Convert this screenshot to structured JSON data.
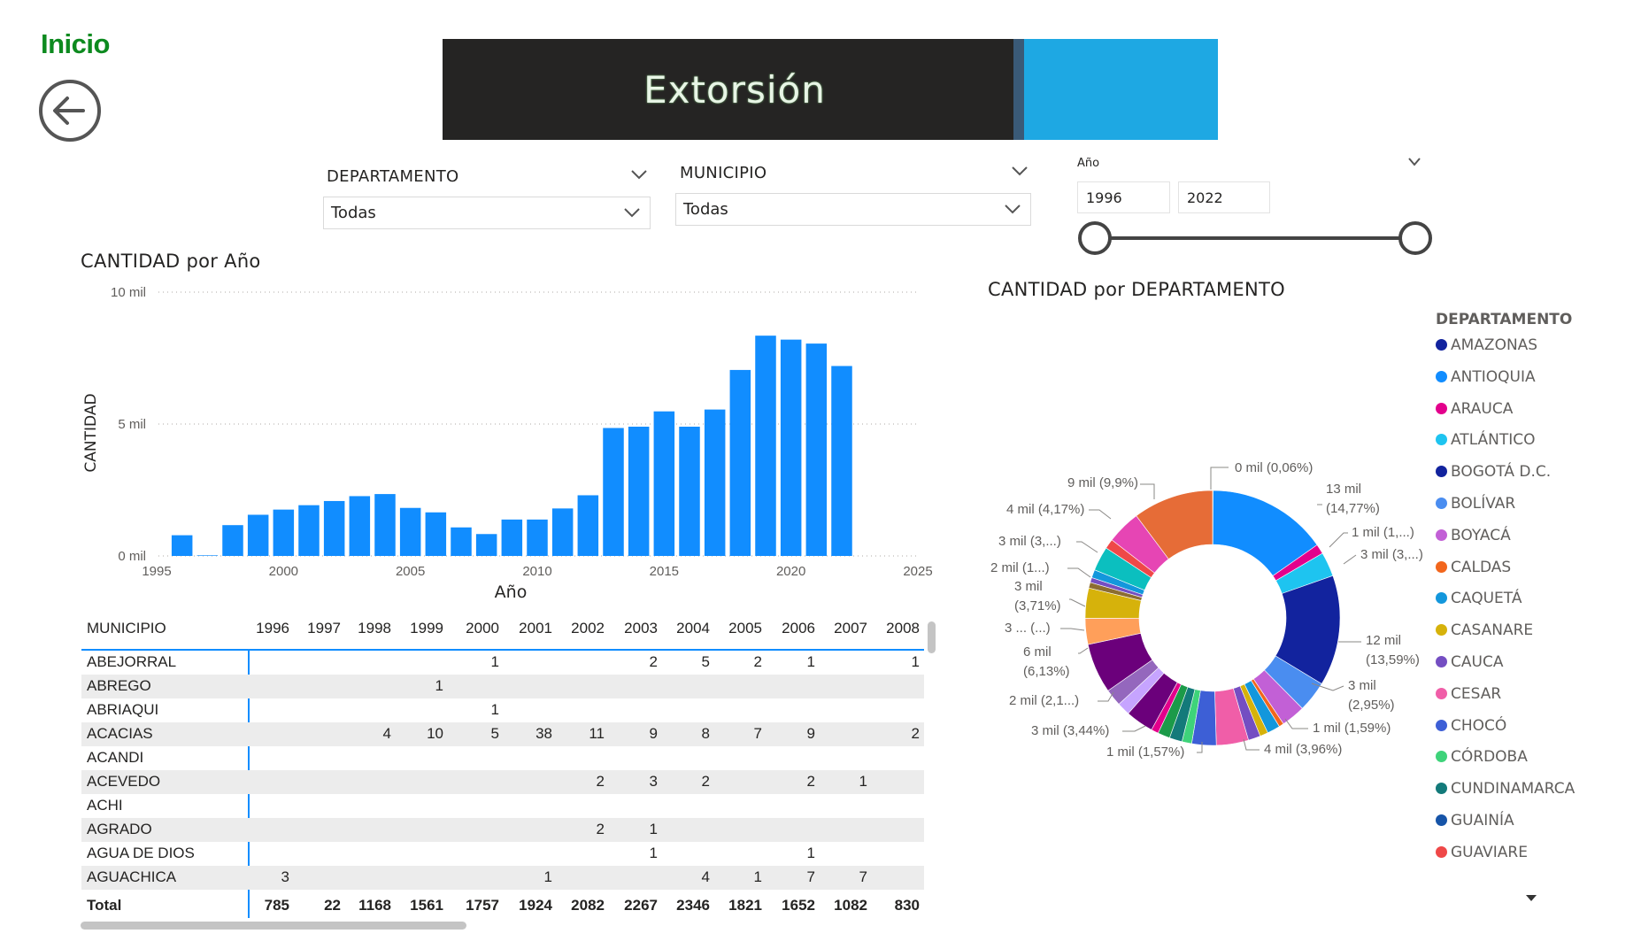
{
  "nav": {
    "home_label": "Inicio",
    "back_icon": "back-arrow-circle-icon"
  },
  "header": {
    "title": "Extorsión"
  },
  "filters": {
    "departamento": {
      "label": "DEPARTAMENTO",
      "value": "Todas"
    },
    "municipio": {
      "label": "MUNICIPIO",
      "value": "Todas"
    },
    "year": {
      "label": "Año",
      "from": "1996",
      "to": "2022"
    }
  },
  "bar_chart": {
    "title": "CANTIDAD por Año",
    "xlabel": "Año",
    "ylabel": "CANTIDAD",
    "y_ticks": [
      "10 mil",
      "5 mil",
      "0 mil"
    ],
    "x_ticks": [
      "1995",
      "2000",
      "2005",
      "2010",
      "2015",
      "2020",
      "2025"
    ]
  },
  "donut_chart": {
    "title": "CANTIDAD por DEPARTAMENTO",
    "legend_title": "DEPARTAMENTO",
    "labels": [
      {
        "id": "l0",
        "lines": [
          "0 mil (0,06%)"
        ]
      },
      {
        "id": "l1",
        "lines": [
          "13 mil",
          "(14,77%)"
        ]
      },
      {
        "id": "l2",
        "lines": [
          "1 mil (1,...)"
        ]
      },
      {
        "id": "l3",
        "lines": [
          "3 mil (3,...)"
        ]
      },
      {
        "id": "l4",
        "lines": [
          "12 mil",
          "(13,59%)"
        ]
      },
      {
        "id": "l5",
        "lines": [
          "3 mil",
          "(2,95%)"
        ]
      },
      {
        "id": "l6",
        "lines": [
          "1 mil (1,59%)"
        ]
      },
      {
        "id": "l7",
        "lines": [
          "4 mil (3,96%)"
        ]
      },
      {
        "id": "l8",
        "lines": [
          "1 mil (1,57%)"
        ]
      },
      {
        "id": "l9",
        "lines": [
          "3 mil (3,44%)"
        ]
      },
      {
        "id": "l10",
        "lines": [
          "2 mil (2,1...)"
        ]
      },
      {
        "id": "l11",
        "lines": [
          "6 mil",
          "(6,13%)"
        ]
      },
      {
        "id": "l12",
        "lines": [
          "3 ... (...)"
        ]
      },
      {
        "id": "l13",
        "lines": [
          "3 mil",
          "(3,71%)"
        ]
      },
      {
        "id": "l14",
        "lines": [
          "2 mil (1...)"
        ]
      },
      {
        "id": "l15",
        "lines": [
          "3 mil (3,...)"
        ]
      },
      {
        "id": "l16",
        "lines": [
          "4 mil (4,17%)"
        ]
      },
      {
        "id": "l17",
        "lines": [
          "9 mil (9,9%)"
        ]
      }
    ]
  },
  "legend": [
    {
      "name": "AMAZONAS",
      "color": "#12239e"
    },
    {
      "name": "ANTIOQUIA",
      "color": "#118dff"
    },
    {
      "name": "ARAUCA",
      "color": "#e3008c"
    },
    {
      "name": "ATLÁNTICO",
      "color": "#1ec4f0"
    },
    {
      "name": "BOGOTÁ D.C.",
      "color": "#12239e"
    },
    {
      "name": "BOLÍVAR",
      "color": "#4a8df0"
    },
    {
      "name": "BOYACÁ",
      "color": "#c260d6"
    },
    {
      "name": "CALDAS",
      "color": "#f2661c"
    },
    {
      "name": "CAQUETÁ",
      "color": "#1397dc"
    },
    {
      "name": "CASANARE",
      "color": "#d6b20b"
    },
    {
      "name": "CAUCA",
      "color": "#744ec2"
    },
    {
      "name": "CESAR",
      "color": "#f05ea8"
    },
    {
      "name": "CHOCÓ",
      "color": "#3d5fd6"
    },
    {
      "name": "CÓRDOBA",
      "color": "#3ed37a"
    },
    {
      "name": "CUNDINAMARCA",
      "color": "#137a7a"
    },
    {
      "name": "GUAINÍA",
      "color": "#1654a8"
    },
    {
      "name": "GUAVIARE",
      "color": "#ef4848"
    }
  ],
  "chart_data": [
    {
      "type": "bar",
      "title": "CANTIDAD por Año",
      "xlabel": "Año",
      "ylabel": "CANTIDAD",
      "x": [
        1996,
        1997,
        1998,
        1999,
        2000,
        2001,
        2002,
        2003,
        2004,
        2005,
        2006,
        2007,
        2008,
        2009,
        2010,
        2011,
        2012,
        2013,
        2014,
        2015,
        2016,
        2017,
        2018,
        2019,
        2020,
        2021,
        2022
      ],
      "values": [
        785,
        22,
        1168,
        1561,
        1757,
        1924,
        2082,
        2267,
        2346,
        1821,
        1652,
        1082,
        830,
        1380,
        1380,
        1800,
        2300,
        4850,
        4900,
        5480,
        4900,
        5550,
        7050,
        8350,
        8200,
        8050,
        7200
      ],
      "xlim": [
        1995,
        2025
      ],
      "ylim": [
        0,
        10000
      ],
      "color": "#118dff",
      "grid": true
    },
    {
      "type": "pie",
      "title": "CANTIDAD por DEPARTAMENTO",
      "values": [
        0.06,
        14.77,
        1.2,
        3.0,
        13.59,
        3.8,
        2.95,
        0.6,
        1.59,
        1.0,
        1.5,
        3.96,
        3.0,
        1.2,
        1.57,
        1.5,
        0.9,
        3.44,
        1.6,
        2.1,
        6.13,
        3.2,
        3.71,
        0.7,
        0.6,
        1.0,
        3.0,
        1.2,
        4.17,
        9.9
      ],
      "colors": [
        "#6b8e23",
        "#118dff",
        "#e3008c",
        "#1ec4f0",
        "#12239e",
        "#4a8df0",
        "#c260d6",
        "#f2661c",
        "#1397dc",
        "#d6b20b",
        "#744ec2",
        "#f05ea8",
        "#3d5fd6",
        "#3ed37a",
        "#137a7a",
        "#1c9a49",
        "#e3008c",
        "#6b007b",
        "#c6a4ff",
        "#9467bd",
        "#6b007b",
        "#ff9f5a",
        "#d6b20b",
        "#8c6d31",
        "#744ec2",
        "#1397dc",
        "#0bbfbf",
        "#ef4848",
        "#e645b4",
        "#e66c37"
      ]
    }
  ],
  "matrix": {
    "header_label": "MUNICIPIO",
    "years": [
      "1996",
      "1997",
      "1998",
      "1999",
      "2000",
      "2001",
      "2002",
      "2003",
      "2004",
      "2005",
      "2006",
      "2007",
      "2008"
    ],
    "rows": [
      {
        "name": "ABEJORRAL",
        "values": [
          "",
          "",
          "",
          "",
          "1",
          "",
          "",
          "2",
          "5",
          "2",
          "1",
          "",
          "1"
        ]
      },
      {
        "name": "ABREGO",
        "values": [
          "",
          "",
          "",
          "1",
          "",
          "",
          "",
          "",
          "",
          "",
          "",
          "",
          ""
        ]
      },
      {
        "name": "ABRIAQUI",
        "values": [
          "",
          "",
          "",
          "",
          "1",
          "",
          "",
          "",
          "",
          "",
          "",
          "",
          ""
        ]
      },
      {
        "name": "ACACIAS",
        "values": [
          "",
          "",
          "4",
          "10",
          "5",
          "38",
          "11",
          "9",
          "8",
          "7",
          "9",
          "",
          "2"
        ]
      },
      {
        "name": "ACANDI",
        "values": [
          "",
          "",
          "",
          "",
          "",
          "",
          "",
          "",
          "",
          "",
          "",
          "",
          ""
        ]
      },
      {
        "name": "ACEVEDO",
        "values": [
          "",
          "",
          "",
          "",
          "",
          "",
          "2",
          "3",
          "2",
          "",
          "2",
          "1",
          ""
        ]
      },
      {
        "name": "ACHI",
        "values": [
          "",
          "",
          "",
          "",
          "",
          "",
          "",
          "",
          "",
          "",
          "",
          "",
          ""
        ]
      },
      {
        "name": "AGRADO",
        "values": [
          "",
          "",
          "",
          "",
          "",
          "",
          "2",
          "1",
          "",
          "",
          "",
          "",
          ""
        ]
      },
      {
        "name": "AGUA DE DIOS",
        "values": [
          "",
          "",
          "",
          "",
          "",
          "",
          "",
          "1",
          "",
          "",
          "1",
          "",
          ""
        ]
      },
      {
        "name": "AGUACHICA",
        "values": [
          "3",
          "",
          "",
          "",
          "",
          "1",
          "",
          "",
          "4",
          "1",
          "7",
          "7",
          ""
        ]
      }
    ],
    "total_label": "Total",
    "totals": [
      "785",
      "22",
      "1168",
      "1561",
      "1757",
      "1924",
      "2082",
      "2267",
      "2346",
      "1821",
      "1652",
      "1082",
      "830"
    ]
  }
}
